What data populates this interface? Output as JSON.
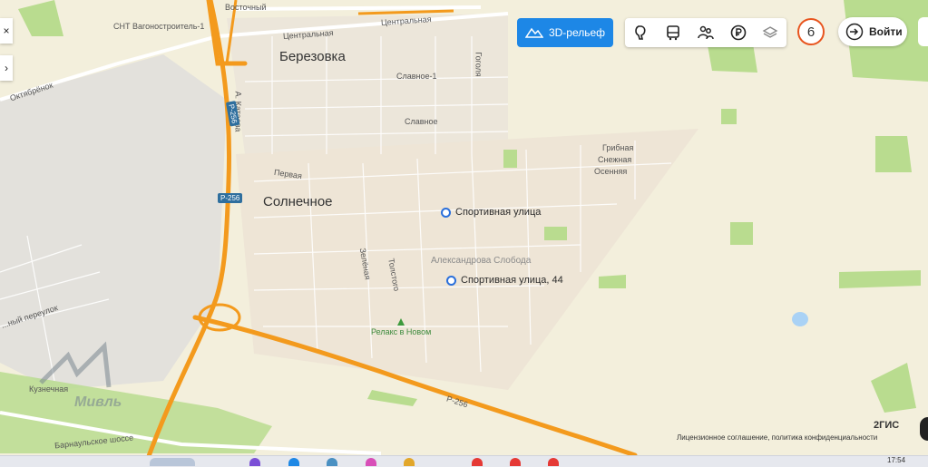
{
  "map": {
    "colors": {
      "land": "#f3efdc",
      "urban": "#e9e5db",
      "highway": "#f39a1d",
      "forest": "#b9dc8f",
      "water": "#a9d2f5",
      "road": "#ffffff"
    },
    "labels": {
      "town_berezovka": "Березовка",
      "town_solnechnoe": "Солнечное",
      "snt": "СНТ Вагоностроитель-1",
      "vostochny": "Восточный",
      "centralnaya1": "Центральная",
      "centralnaya2": "Центральная",
      "oktyabrenok": "Октябрёнок",
      "slavnoe1": "Славное-1",
      "slavnoe": "Славное",
      "gogolya": "Гоголя",
      "kataeva": "А. Катаева",
      "pervaya": "Первая",
      "gribnaya": "Грибная",
      "snezhnaya": "Снежная",
      "osennyaya": "Осенняя",
      "alex_sloboda": "Александрова Слобода",
      "zelenaya": "Зелёная",
      "tolstogo": "Толстого",
      "pereulok": "...ный переулок",
      "kuznechnaya": "Кузнечная",
      "barnaul_shosse": "Барнаульское шоссе"
    },
    "highways": {
      "r256_a": "Р-256",
      "r256_b": "Р-256",
      "r256_c": "Р-256"
    },
    "pois": {
      "sport_street": "Спортивная улица",
      "sport_street_44": "Спортивная улица, 44",
      "relax": "Релакс в Новом"
    }
  },
  "controls": {
    "relief_button": "3D-рельеф",
    "toolbar_icons": [
      "attractions-icon",
      "transport-icon",
      "people-icon",
      "ruble-icon",
      "layers-icon"
    ],
    "notification_count": "6",
    "login_label": "Войти",
    "side_close": "×",
    "side_expand": "›"
  },
  "footer": {
    "brand": "2ГИС",
    "license": "Лицензионное соглашение, политика конфиденциальности"
  },
  "taskbar": {
    "clock": "17:54"
  },
  "watermark": {
    "text": "Мивль"
  }
}
